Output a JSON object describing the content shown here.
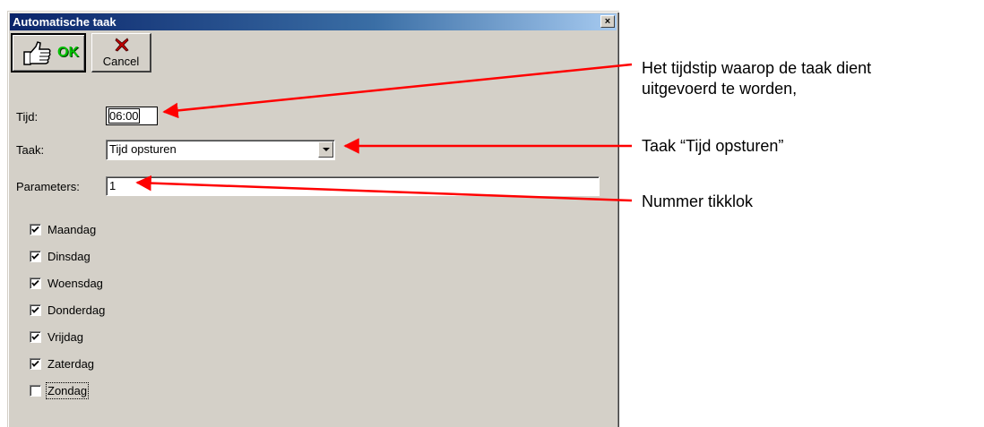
{
  "window": {
    "title": "Automatische taak",
    "close_glyph": "×"
  },
  "toolbar": {
    "ok_label": "OK",
    "ok_icon": "thumbs-up-icon",
    "cancel_label": "Cancel",
    "cancel_icon": "red-x-icon"
  },
  "form": {
    "tijd_label": "Tijd:",
    "tijd_value": "06:00",
    "taak_label": "Taak:",
    "taak_value": "Tijd opsturen",
    "parameters_label": "Parameters:",
    "parameters_value": "1"
  },
  "days": [
    {
      "label": "Maandag",
      "checked": true
    },
    {
      "label": "Dinsdag",
      "checked": true
    },
    {
      "label": "Woensdag",
      "checked": true
    },
    {
      "label": "Donderdag",
      "checked": true
    },
    {
      "label": "Vrijdag",
      "checked": true
    },
    {
      "label": "Zaterdag",
      "checked": true
    },
    {
      "label": "Zondag",
      "checked": false
    }
  ],
  "annotations": {
    "note_time_line1": "Het tijdstip waarop de taak dient",
    "note_time_line2": "uitgevoerd te worden,",
    "note_task": "Taak “Tijd opsturen”",
    "note_param": "Nummer tikklok",
    "arrow_color": "#ff0000"
  },
  "colors": {
    "dialog_bg": "#d4d0c8",
    "title_gradient_start": "#0a246a",
    "ok_green": "#00c000"
  }
}
